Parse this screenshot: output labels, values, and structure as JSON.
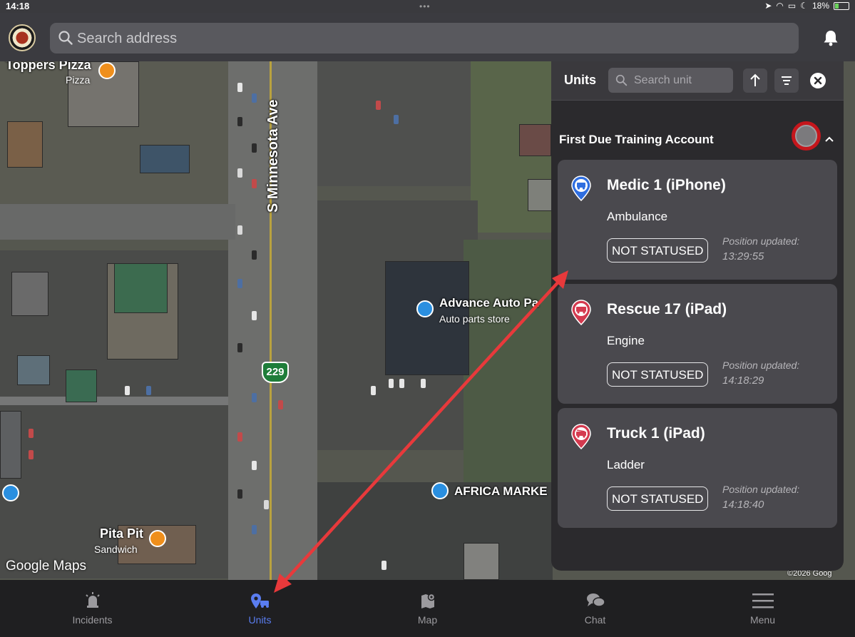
{
  "status_bar": {
    "time": "14:18",
    "battery": "18%"
  },
  "top_bar": {
    "search_placeholder": "Search address",
    "logo_icon": "fire-department-badge-icon",
    "notification_icon": "bell-icon"
  },
  "map": {
    "labels": {
      "street": "S Minnesota Ave",
      "toppers_name": "Toppers Pizza",
      "toppers_sub": "Pizza",
      "advance_name": "Advance Auto Pa",
      "advance_sub": "Auto parts store",
      "africa": "AFRICA MARKE",
      "pita_name": "Pita Pit",
      "pita_sub": "Sandwich",
      "interstate": "229"
    },
    "attribution": "Google Maps",
    "copyright": "©2026 Goog"
  },
  "units_panel": {
    "title": "Units",
    "search_placeholder": "Search unit",
    "account": {
      "name": "First Due Training Account"
    },
    "units": [
      {
        "name": "Medic 1 (iPhone)",
        "type": "Ambulance",
        "status": "NOT STATUSED",
        "updated_label": "Position updated:",
        "updated_time": "13:29:55",
        "icon": "ambulance-pin-icon",
        "color": "#2f6ee0"
      },
      {
        "name": "Rescue 17 (iPad)",
        "type": "Engine",
        "status": "NOT STATUSED",
        "updated_label": "Position updated:",
        "updated_time": "14:18:29",
        "icon": "fire-engine-pin-icon",
        "color": "#d43a4f"
      },
      {
        "name": "Truck 1 (iPad)",
        "type": "Ladder",
        "status": "NOT STATUSED",
        "updated_label": "Position updated:",
        "updated_time": "14:18:40",
        "icon": "fire-truck-pin-icon",
        "color": "#d43a4f"
      }
    ]
  },
  "bottom_nav": {
    "items": [
      {
        "label": "Incidents",
        "icon": "alarm-light-icon"
      },
      {
        "label": "Units",
        "icon": "units-pin-icon",
        "active": true
      },
      {
        "label": "Map",
        "icon": "map-pin-icon"
      },
      {
        "label": "Chat",
        "icon": "chat-bubbles-icon"
      },
      {
        "label": "Menu",
        "icon": "hamburger-menu-icon"
      }
    ]
  },
  "colors": {
    "accent": "#5a7df0",
    "annotation_arrow": "#e8393b",
    "toggle_ring": "#c5161c"
  }
}
